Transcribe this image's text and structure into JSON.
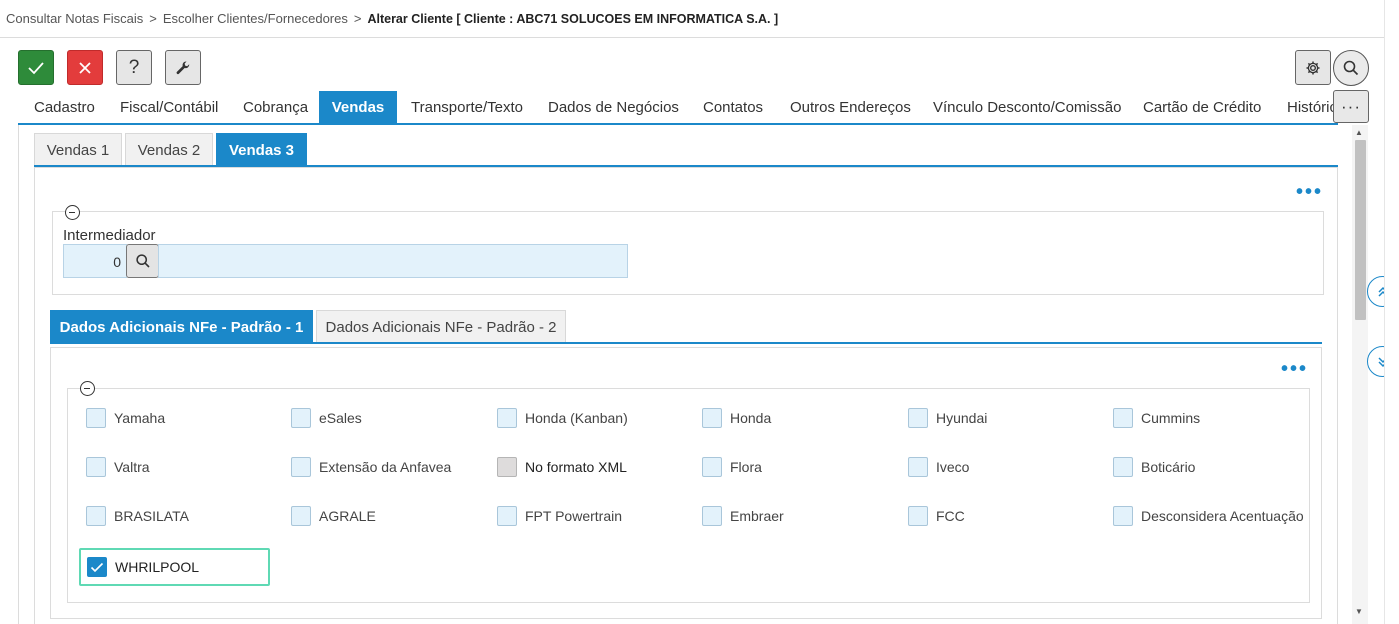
{
  "breadcrumb": {
    "items": [
      "Consultar Notas Fiscais",
      "Escolher Clientes/Fornecedores"
    ],
    "separator": ">",
    "current": "Alterar Cliente [ Cliente : ABC71 SOLUCOES EM INFORMATICA S.A. ]"
  },
  "toolbar": {
    "help_label": "?",
    "more_label": "···"
  },
  "main_tabs": [
    "Cadastro",
    "Fiscal/Contábil",
    "Cobrança",
    "Vendas",
    "Transporte/Texto",
    "Dados de Negócios",
    "Contatos",
    "Outros Endereços",
    "Vínculo Desconto/Comissão",
    "Cartão de Crédito",
    "Históric"
  ],
  "main_tabs_active": "Vendas",
  "sub_tabs": [
    "Vendas 1",
    "Vendas 2",
    "Vendas 3"
  ],
  "sub_tabs_active": "Vendas 3",
  "intermediador": {
    "label": "Intermediador",
    "code": "0",
    "description": ""
  },
  "dados_tabs": [
    "Dados Adicionais NFe - Padrão - 1",
    "Dados Adicionais NFe - Padrão - 2"
  ],
  "dados_tabs_active": "Dados Adicionais NFe - Padrão - 1",
  "checkboxes": [
    {
      "label": "Yamaha",
      "checked": false
    },
    {
      "label": "eSales",
      "checked": false
    },
    {
      "label": "Honda (Kanban)",
      "checked": false
    },
    {
      "label": "Honda",
      "checked": false
    },
    {
      "label": "Hyundai",
      "checked": false
    },
    {
      "label": "Cummins",
      "checked": false
    },
    {
      "label": "Valtra",
      "checked": false
    },
    {
      "label": "Extensão da Anfavea",
      "checked": false
    },
    {
      "label": "No formato XML",
      "checked": false,
      "disabled": true
    },
    {
      "label": "Flora",
      "checked": false
    },
    {
      "label": "Iveco",
      "checked": false
    },
    {
      "label": "Boticário",
      "checked": false
    },
    {
      "label": "BRASILATA",
      "checked": false
    },
    {
      "label": "AGRALE",
      "checked": false
    },
    {
      "label": "FPT Powertrain",
      "checked": false
    },
    {
      "label": "Embraer",
      "checked": false
    },
    {
      "label": "FCC",
      "checked": false
    },
    {
      "label": "Desconsidera Acentuação",
      "checked": false
    },
    {
      "label": "WHRILPOOL",
      "checked": true
    }
  ],
  "colors": {
    "accent": "#1b88c9",
    "ok": "#2e8b3a",
    "cancel": "#e33c3c",
    "focus": "#5fd9b4"
  }
}
